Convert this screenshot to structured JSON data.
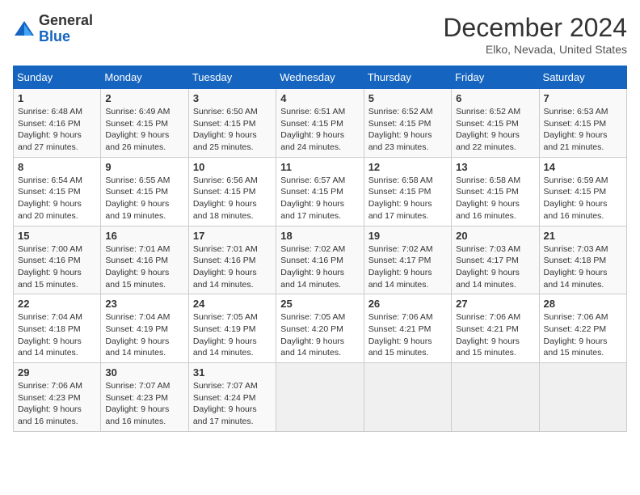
{
  "header": {
    "logo_line1": "General",
    "logo_line2": "Blue",
    "month_title": "December 2024",
    "location": "Elko, Nevada, United States"
  },
  "days_of_week": [
    "Sunday",
    "Monday",
    "Tuesday",
    "Wednesday",
    "Thursday",
    "Friday",
    "Saturday"
  ],
  "weeks": [
    [
      {
        "day": "1",
        "lines": [
          "Sunrise: 6:48 AM",
          "Sunset: 4:16 PM",
          "Daylight: 9 hours",
          "and 27 minutes."
        ]
      },
      {
        "day": "2",
        "lines": [
          "Sunrise: 6:49 AM",
          "Sunset: 4:15 PM",
          "Daylight: 9 hours",
          "and 26 minutes."
        ]
      },
      {
        "day": "3",
        "lines": [
          "Sunrise: 6:50 AM",
          "Sunset: 4:15 PM",
          "Daylight: 9 hours",
          "and 25 minutes."
        ]
      },
      {
        "day": "4",
        "lines": [
          "Sunrise: 6:51 AM",
          "Sunset: 4:15 PM",
          "Daylight: 9 hours",
          "and 24 minutes."
        ]
      },
      {
        "day": "5",
        "lines": [
          "Sunrise: 6:52 AM",
          "Sunset: 4:15 PM",
          "Daylight: 9 hours",
          "and 23 minutes."
        ]
      },
      {
        "day": "6",
        "lines": [
          "Sunrise: 6:52 AM",
          "Sunset: 4:15 PM",
          "Daylight: 9 hours",
          "and 22 minutes."
        ]
      },
      {
        "day": "7",
        "lines": [
          "Sunrise: 6:53 AM",
          "Sunset: 4:15 PM",
          "Daylight: 9 hours",
          "and 21 minutes."
        ]
      }
    ],
    [
      {
        "day": "8",
        "lines": [
          "Sunrise: 6:54 AM",
          "Sunset: 4:15 PM",
          "Daylight: 9 hours",
          "and 20 minutes."
        ]
      },
      {
        "day": "9",
        "lines": [
          "Sunrise: 6:55 AM",
          "Sunset: 4:15 PM",
          "Daylight: 9 hours",
          "and 19 minutes."
        ]
      },
      {
        "day": "10",
        "lines": [
          "Sunrise: 6:56 AM",
          "Sunset: 4:15 PM",
          "Daylight: 9 hours",
          "and 18 minutes."
        ]
      },
      {
        "day": "11",
        "lines": [
          "Sunrise: 6:57 AM",
          "Sunset: 4:15 PM",
          "Daylight: 9 hours",
          "and 17 minutes."
        ]
      },
      {
        "day": "12",
        "lines": [
          "Sunrise: 6:58 AM",
          "Sunset: 4:15 PM",
          "Daylight: 9 hours",
          "and 17 minutes."
        ]
      },
      {
        "day": "13",
        "lines": [
          "Sunrise: 6:58 AM",
          "Sunset: 4:15 PM",
          "Daylight: 9 hours",
          "and 16 minutes."
        ]
      },
      {
        "day": "14",
        "lines": [
          "Sunrise: 6:59 AM",
          "Sunset: 4:15 PM",
          "Daylight: 9 hours",
          "and 16 minutes."
        ]
      }
    ],
    [
      {
        "day": "15",
        "lines": [
          "Sunrise: 7:00 AM",
          "Sunset: 4:16 PM",
          "Daylight: 9 hours",
          "and 15 minutes."
        ]
      },
      {
        "day": "16",
        "lines": [
          "Sunrise: 7:01 AM",
          "Sunset: 4:16 PM",
          "Daylight: 9 hours",
          "and 15 minutes."
        ]
      },
      {
        "day": "17",
        "lines": [
          "Sunrise: 7:01 AM",
          "Sunset: 4:16 PM",
          "Daylight: 9 hours",
          "and 14 minutes."
        ]
      },
      {
        "day": "18",
        "lines": [
          "Sunrise: 7:02 AM",
          "Sunset: 4:16 PM",
          "Daylight: 9 hours",
          "and 14 minutes."
        ]
      },
      {
        "day": "19",
        "lines": [
          "Sunrise: 7:02 AM",
          "Sunset: 4:17 PM",
          "Daylight: 9 hours",
          "and 14 minutes."
        ]
      },
      {
        "day": "20",
        "lines": [
          "Sunrise: 7:03 AM",
          "Sunset: 4:17 PM",
          "Daylight: 9 hours",
          "and 14 minutes."
        ]
      },
      {
        "day": "21",
        "lines": [
          "Sunrise: 7:03 AM",
          "Sunset: 4:18 PM",
          "Daylight: 9 hours",
          "and 14 minutes."
        ]
      }
    ],
    [
      {
        "day": "22",
        "lines": [
          "Sunrise: 7:04 AM",
          "Sunset: 4:18 PM",
          "Daylight: 9 hours",
          "and 14 minutes."
        ]
      },
      {
        "day": "23",
        "lines": [
          "Sunrise: 7:04 AM",
          "Sunset: 4:19 PM",
          "Daylight: 9 hours",
          "and 14 minutes."
        ]
      },
      {
        "day": "24",
        "lines": [
          "Sunrise: 7:05 AM",
          "Sunset: 4:19 PM",
          "Daylight: 9 hours",
          "and 14 minutes."
        ]
      },
      {
        "day": "25",
        "lines": [
          "Sunrise: 7:05 AM",
          "Sunset: 4:20 PM",
          "Daylight: 9 hours",
          "and 14 minutes."
        ]
      },
      {
        "day": "26",
        "lines": [
          "Sunrise: 7:06 AM",
          "Sunset: 4:21 PM",
          "Daylight: 9 hours",
          "and 15 minutes."
        ]
      },
      {
        "day": "27",
        "lines": [
          "Sunrise: 7:06 AM",
          "Sunset: 4:21 PM",
          "Daylight: 9 hours",
          "and 15 minutes."
        ]
      },
      {
        "day": "28",
        "lines": [
          "Sunrise: 7:06 AM",
          "Sunset: 4:22 PM",
          "Daylight: 9 hours",
          "and 15 minutes."
        ]
      }
    ],
    [
      {
        "day": "29",
        "lines": [
          "Sunrise: 7:06 AM",
          "Sunset: 4:23 PM",
          "Daylight: 9 hours",
          "and 16 minutes."
        ]
      },
      {
        "day": "30",
        "lines": [
          "Sunrise: 7:07 AM",
          "Sunset: 4:23 PM",
          "Daylight: 9 hours",
          "and 16 minutes."
        ]
      },
      {
        "day": "31",
        "lines": [
          "Sunrise: 7:07 AM",
          "Sunset: 4:24 PM",
          "Daylight: 9 hours",
          "and 17 minutes."
        ]
      },
      null,
      null,
      null,
      null
    ]
  ]
}
